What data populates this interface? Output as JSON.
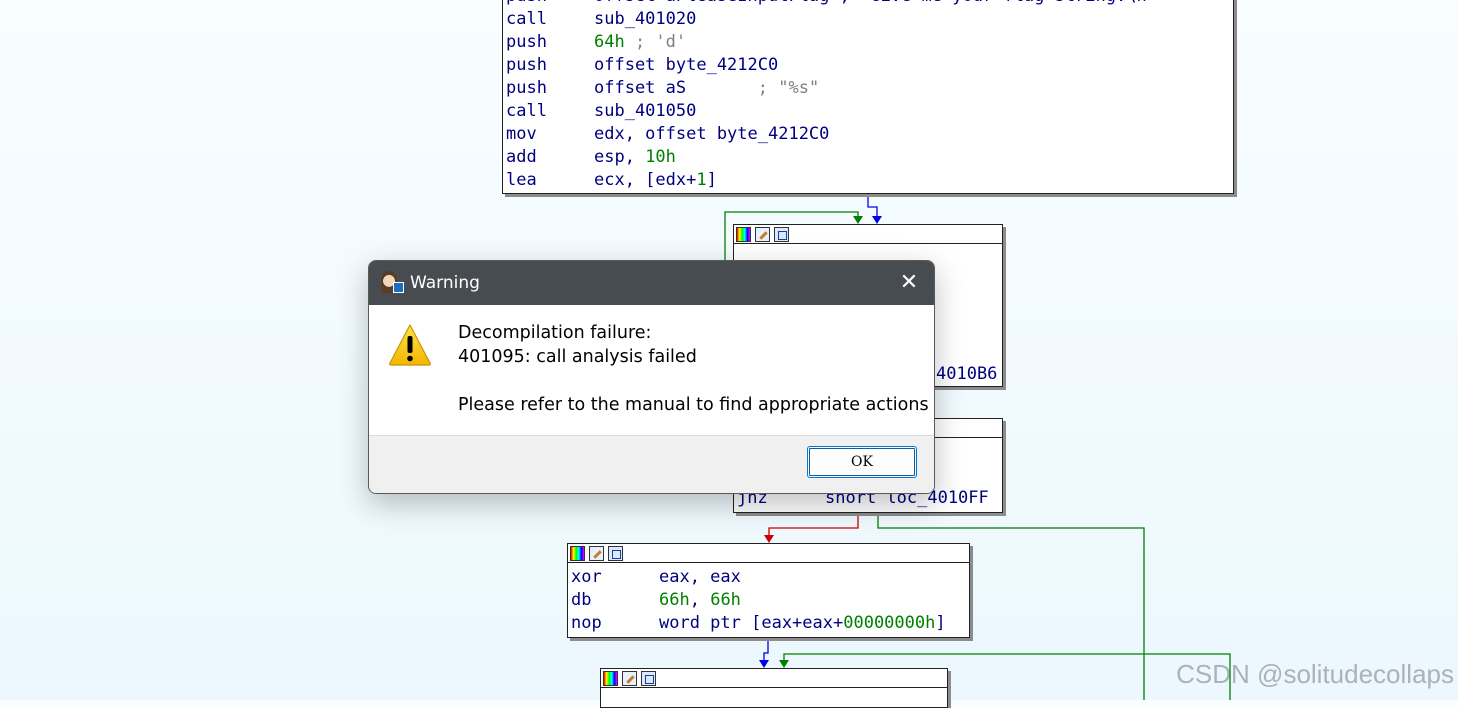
{
  "code_blocks": {
    "top": {
      "lines": [
        {
          "mnemonic": "push",
          "parts": [
            {
              "t": "offset aPleaseInputFlag ; \"Give me your flag string:\\n\"",
              "c": "op"
            }
          ]
        },
        {
          "mnemonic": "call",
          "parts": [
            {
              "t": "sub_401020",
              "c": "op"
            }
          ]
        },
        {
          "mnemonic": "push",
          "parts": [
            {
              "t": "64h",
              "c": "num"
            },
            {
              "t": " ; 'd'",
              "c": "cmt"
            }
          ]
        },
        {
          "mnemonic": "push",
          "parts": [
            {
              "t": "offset byte_4212C0",
              "c": "op"
            }
          ]
        },
        {
          "mnemonic": "push",
          "parts": [
            {
              "t": "offset aS       ",
              "c": "op"
            },
            {
              "t": "; \"%s\"",
              "c": "cmt"
            }
          ]
        },
        {
          "mnemonic": "call",
          "parts": [
            {
              "t": "sub_401050",
              "c": "op"
            }
          ]
        },
        {
          "mnemonic": "mov",
          "parts": [
            {
              "t": "edx, offset byte_4212C0",
              "c": "op"
            }
          ]
        },
        {
          "mnemonic": "add",
          "parts": [
            {
              "t": "esp, ",
              "c": "op"
            },
            {
              "t": "10h",
              "c": "num"
            }
          ]
        },
        {
          "mnemonic": "lea",
          "parts": [
            {
              "t": "ecx, [edx+",
              "c": "op"
            },
            {
              "t": "1",
              "c": "num"
            },
            {
              "t": "]",
              "c": "op"
            }
          ]
        }
      ]
    },
    "loop": {
      "partial_text": "4010B6"
    },
    "test": {
      "lines": [
        {
          "mnemonic": "jnz",
          "parts": [
            {
              "t": "short loc_4010FF",
              "c": "op"
            }
          ]
        }
      ]
    },
    "junk": {
      "lines": [
        {
          "mnemonic": "xor",
          "parts": [
            {
              "t": "eax, eax",
              "c": "op"
            }
          ]
        },
        {
          "mnemonic": "db",
          "parts": [
            {
              "t": "66h",
              "c": "num"
            },
            {
              "t": ", ",
              "c": "op"
            },
            {
              "t": "66h",
              "c": "num"
            }
          ]
        },
        {
          "mnemonic": "nop",
          "parts": [
            {
              "t": "word ptr [eax+eax+",
              "c": "op"
            },
            {
              "t": "00000000h",
              "c": "num"
            },
            {
              "t": "]",
              "c": "op"
            }
          ]
        }
      ]
    }
  },
  "colors": {
    "code_text": "#000080",
    "number": "#008000",
    "comment": "#808080",
    "edge_true": "#008000",
    "edge_false": "#cc0000",
    "edge_uncond": "#0000ee",
    "dialog_title_bg": "#474c51"
  },
  "dialog": {
    "title": "Warning",
    "app_icon": "ida-app-icon",
    "close_icon": "close-icon",
    "warning_icon": "warning-triangle-icon",
    "message_line1": "Decompilation failure:",
    "message_line2": "401095: call analysis failed",
    "message_line3": "Please refer to the manual to find appropriate actions",
    "ok_label": "OK"
  },
  "watermark": "CSDN @solitudecollaps"
}
